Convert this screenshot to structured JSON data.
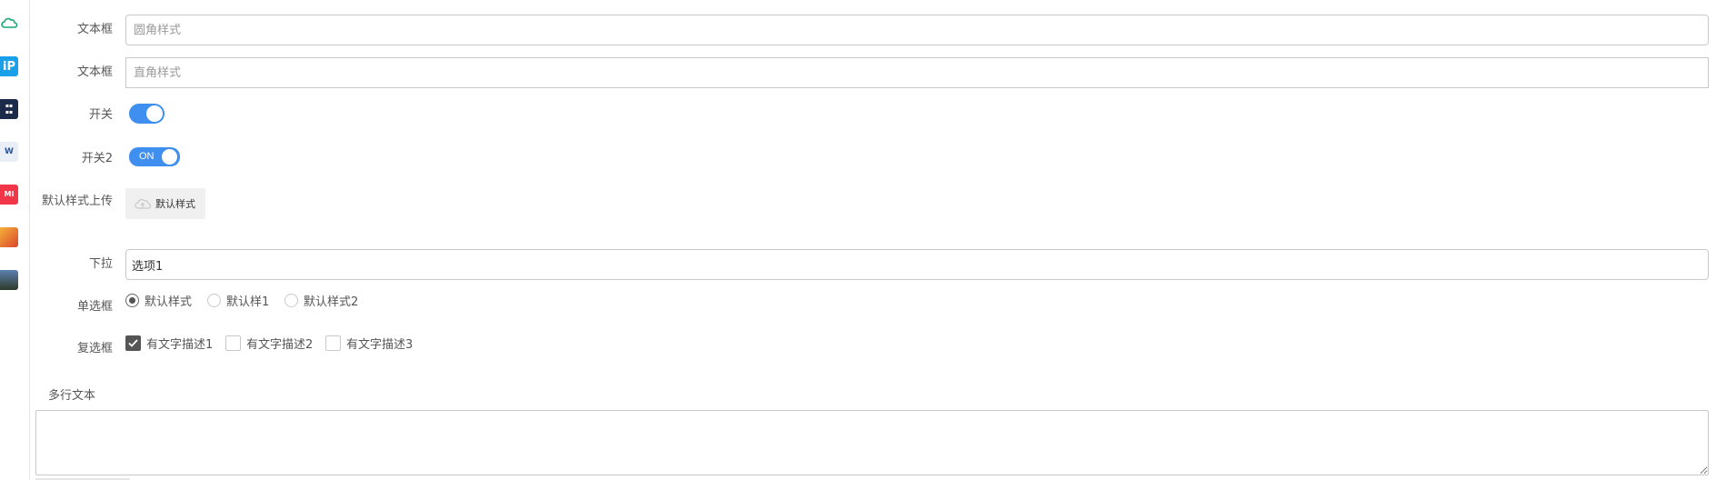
{
  "sidebar": {
    "icons": [
      {
        "name": "cloud-app-icon",
        "text": "",
        "color": "#ffffff"
      },
      {
        "name": "ip-app-icon",
        "text": "iP",
        "color": "#1aa0e8"
      },
      {
        "name": "news-app-icon",
        "text": "",
        "color": "#1c2a4a"
      },
      {
        "name": "word-app-icon",
        "text": "W",
        "color": "#e9eef7"
      },
      {
        "name": "mi-app-icon",
        "text": "MI",
        "color": "#f2364a"
      },
      {
        "name": "game-app-icon-1",
        "text": "",
        "color": "#e0662a"
      },
      {
        "name": "game-app-icon-2",
        "text": "",
        "color": "#2f4468"
      }
    ]
  },
  "form": {
    "text1": {
      "label": "文本框",
      "placeholder": "圆角样式"
    },
    "text2": {
      "label": "文本框",
      "placeholder": "直角样式"
    },
    "switch1": {
      "label": "开关",
      "on": true
    },
    "switch2": {
      "label": "开关2",
      "on": true,
      "on_text": "ON"
    },
    "upload": {
      "label": "默认样式上传",
      "button": "默认样式"
    },
    "select": {
      "label": "下拉",
      "value": "选项1"
    },
    "radio": {
      "label": "单选框",
      "options": [
        "默认样式",
        "默认样1",
        "默认样式2"
      ],
      "selected_index": 0
    },
    "checkbox": {
      "label": "复选框",
      "options": [
        "有文字描述1",
        "有文字描述2",
        "有文字描述3"
      ],
      "checked": [
        true,
        false,
        false
      ]
    },
    "textarea": {
      "label": "多行文本",
      "value": ""
    }
  },
  "colors": {
    "accent": "#3f8ff0",
    "checked": "#555555",
    "border": "#c9c9c9"
  }
}
